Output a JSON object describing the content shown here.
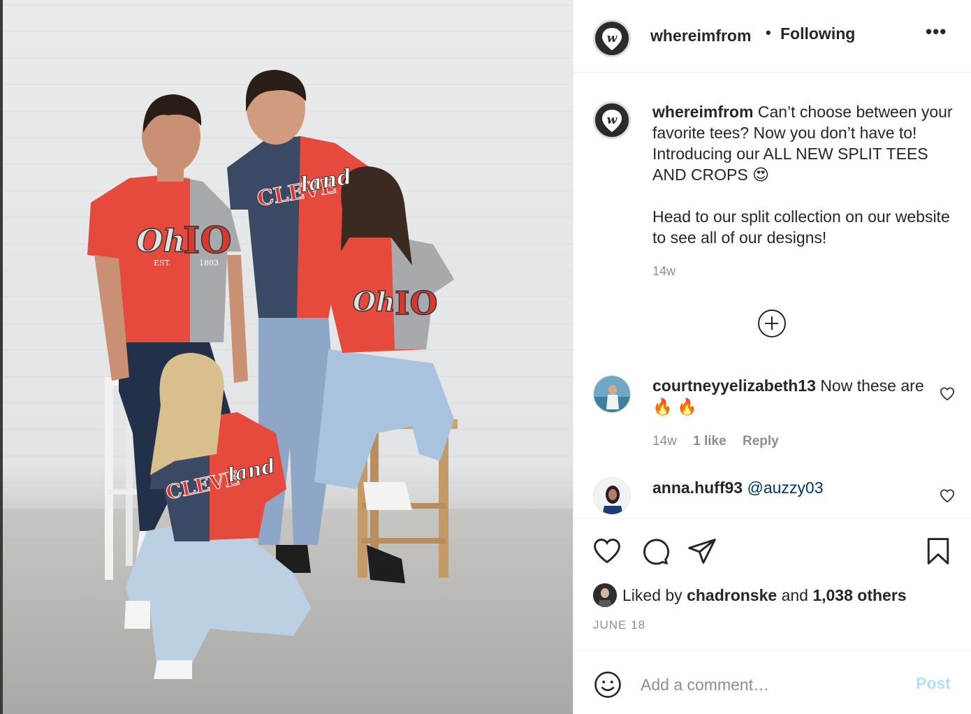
{
  "header": {
    "username": "whereimfrom",
    "separator": "•",
    "follow_status": "Following",
    "more_label": "•••"
  },
  "caption": {
    "username": "whereimfrom",
    "text": "Can’t choose between your favorite tees? Now you don’t have to! Introducing our ALL NEW SPLIT TEES AND CROPS 😍\n\nHead to our split collection on our website to see all of our designs!",
    "time": "14w"
  },
  "photo": {
    "shirt_text_1": "Oh",
    "shirt_text_2": "IO",
    "shirt_text_3": "CLEVE",
    "shirt_text_4": "land",
    "shirt_text_5": "EST.",
    "shirt_text_6": "1803"
  },
  "comments": [
    {
      "username": "courtneyyelizabeth13",
      "text": "Now these are 🔥 🔥",
      "time": "14w",
      "likes": "1 like",
      "reply_label": "Reply"
    },
    {
      "username": "anna.huff93",
      "mention": "@auzzy03"
    }
  ],
  "likes": {
    "prefix": "Liked by",
    "user": "chadronske",
    "conjunction": "and",
    "others": "1,038 others"
  },
  "date": "JUNE 18",
  "add_comment": {
    "placeholder": "Add a comment…",
    "post_label": "Post"
  },
  "icons": {
    "like": "heart-icon",
    "comment": "comment-bubble-icon",
    "share": "paper-plane-icon",
    "save": "bookmark-icon",
    "emoji": "smiley-icon",
    "expand": "plus-circle-icon"
  },
  "colors": {
    "post_button_disabled": "#b2dffc",
    "mention": "#00376b",
    "secondary_text": "#8e8e8e"
  }
}
